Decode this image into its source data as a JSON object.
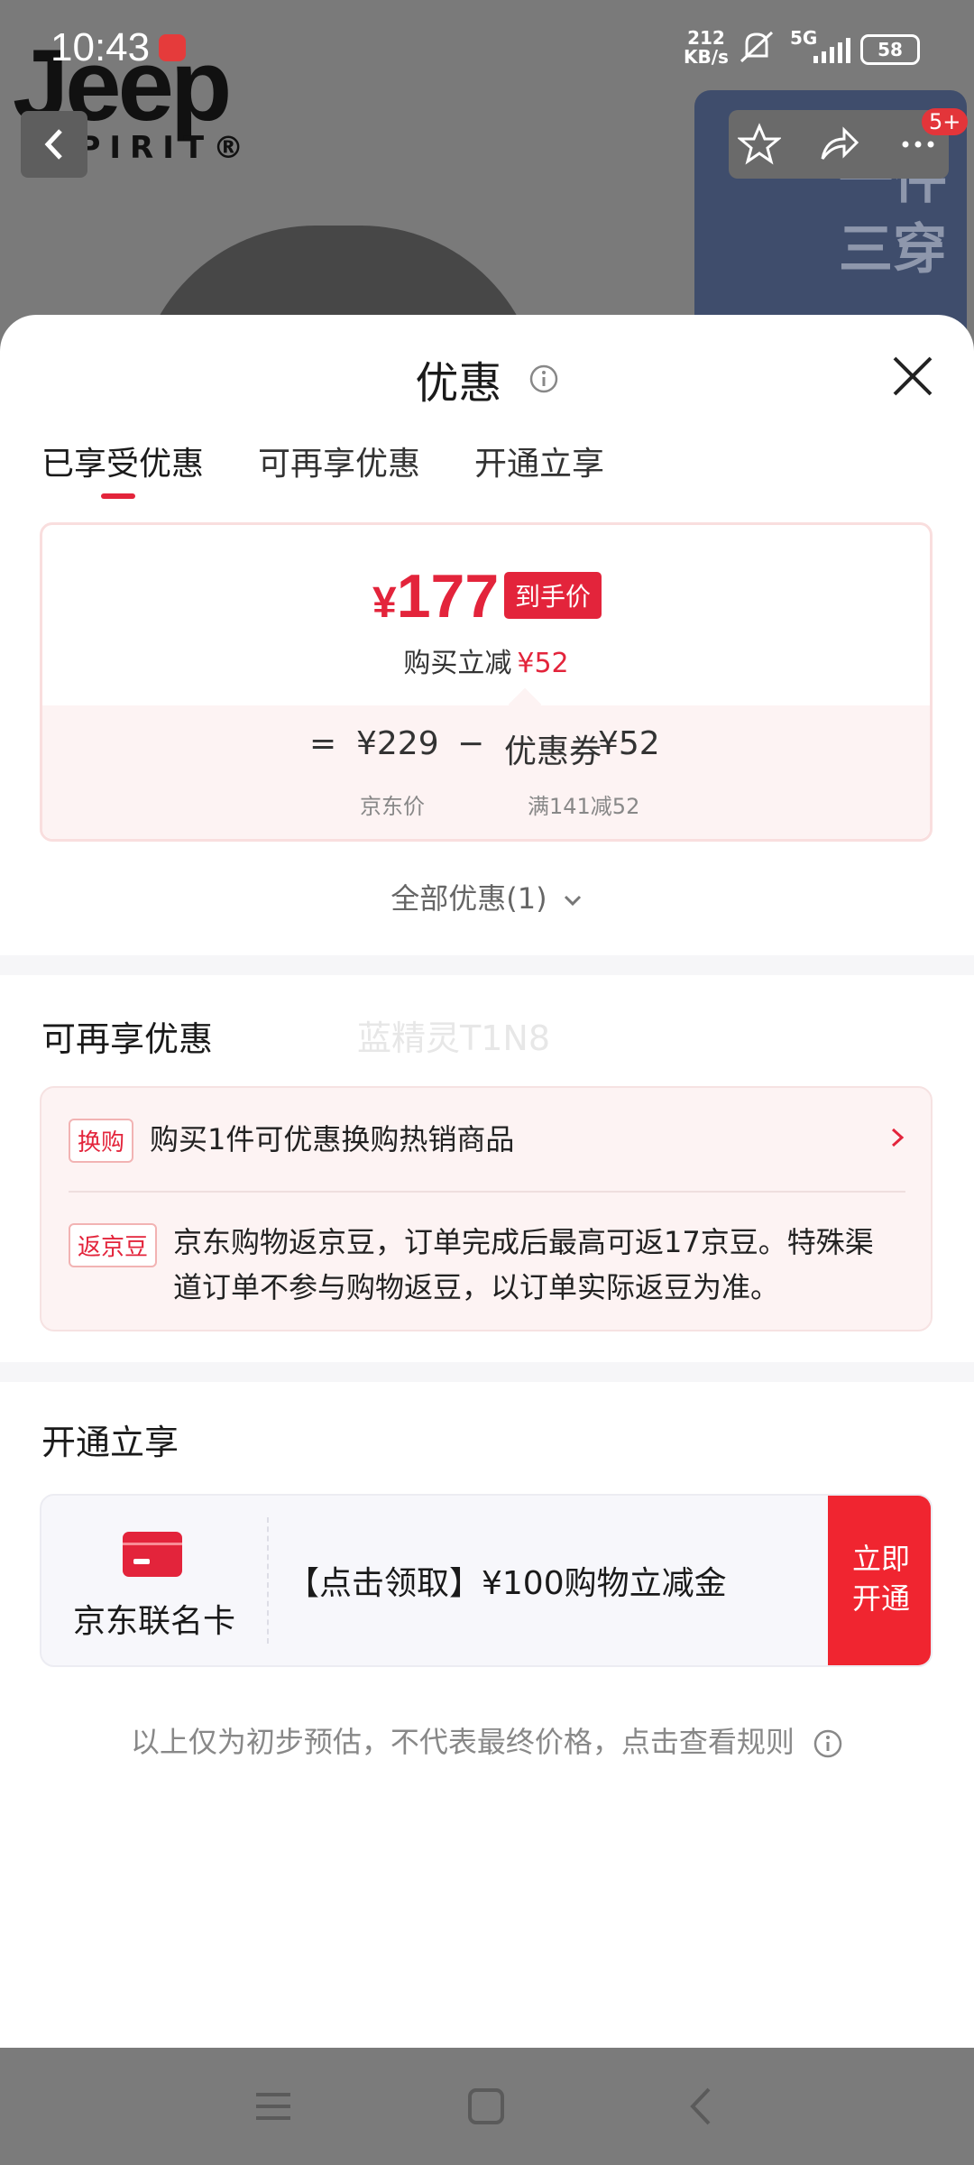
{
  "status_bar": {
    "time": "10:43",
    "net_speed_value": "212",
    "net_speed_unit": "KB/s",
    "signal": "5G",
    "battery": "58"
  },
  "background_page": {
    "brand_logo_text": "Jeep",
    "brand_logo_sub": "SPIRIT®",
    "notification_badge": "5+",
    "promo_card_text_line1": "一件",
    "promo_card_text_line2": "三穿"
  },
  "sheet": {
    "title": "优惠",
    "tabs": [
      {
        "label": "已享受优惠",
        "active": true
      },
      {
        "label": "可再享优惠",
        "active": false
      },
      {
        "label": "开通立享",
        "active": false
      }
    ],
    "price_summary": {
      "currency": "¥",
      "final_price": "177",
      "final_price_tag": "到手价",
      "discount_prefix": "购买立减",
      "discount_amount": "¥52",
      "equals": "=",
      "jd_price": "¥229",
      "minus": "−",
      "coupon_label": "优惠券",
      "coupon_value": "¥52",
      "jd_price_caption": "京东价",
      "coupon_caption": "满141减52"
    },
    "all_offers_label": "全部优惠(1)",
    "extra_section": {
      "title": "可再享优惠",
      "watermark": "蓝精灵T1N8",
      "items": [
        {
          "tag": "换购",
          "text": "购买1件可优惠换购热销商品"
        },
        {
          "tag": "返京豆",
          "text_line1": "京东购物返京豆，订单完成后最高可返17京豆。特殊渠",
          "text_line2": "道订单不参与购物返豆，以订单实际返豆为准。"
        }
      ]
    },
    "open_section": {
      "title": "开通立享",
      "card_name": "京东联名卡",
      "offer_text": "【点击领取】¥100购物立减金",
      "cta_line1": "立即",
      "cta_line2": "开通"
    },
    "disclaimer": "以上仅为初步预估，不代表最终价格，点击查看规则"
  },
  "colors": {
    "accent_red": "#e3243b",
    "cta_red": "#f02530",
    "light_pink_bg": "#fdf3f3"
  },
  "icons": [
    "info-icon",
    "close-icon",
    "chevron-down-icon",
    "chevron-right-icon",
    "credit-card-icon",
    "back-arrow-icon",
    "star-icon",
    "share-icon",
    "more-icon",
    "menu-icon",
    "home-icon",
    "back-icon"
  ]
}
